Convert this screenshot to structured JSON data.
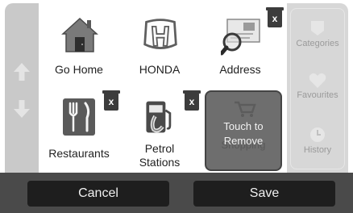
{
  "grid": {
    "tiles": [
      {
        "label": "Go Home",
        "icon": "house-icon"
      },
      {
        "label": "HONDA",
        "icon": "honda-logo-icon"
      },
      {
        "label": "Address",
        "icon": "address-card-icon"
      },
      {
        "label": "Restaurants",
        "icon": "fork-knife-icon"
      },
      {
        "label_line1": "Petrol",
        "label_line2": "Stations",
        "icon": "fuel-pump-icon"
      }
    ],
    "delete_glyph": "x"
  },
  "drop_target": {
    "line1": "Touch to",
    "line2": "Remove",
    "ghost_label": "Shopping"
  },
  "sidebar": {
    "items": [
      {
        "label": "Categories",
        "icon": "categories-icon"
      },
      {
        "label": "Favourites",
        "icon": "heart-icon"
      },
      {
        "label": "History",
        "icon": "clock-icon"
      }
    ]
  },
  "footer": {
    "cancel_label": "Cancel",
    "save_label": "Save"
  },
  "colors": {
    "delete_badge": "#3c3c3c",
    "drop_target": "#6e6e6e",
    "footer_bar": "#4a4a4a",
    "button": "#1e1e1e"
  }
}
